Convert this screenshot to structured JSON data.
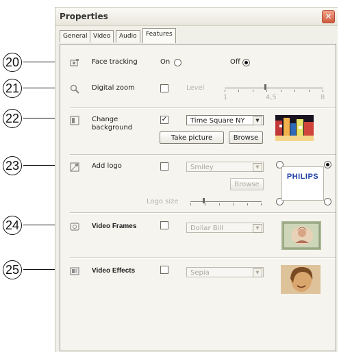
{
  "callouts": [
    "20",
    "21",
    "22",
    "23",
    "24",
    "25"
  ],
  "window": {
    "title": "Properties",
    "close_icon": "close-icon"
  },
  "tabs": [
    {
      "label": "General",
      "active": false
    },
    {
      "label": "Video",
      "active": false
    },
    {
      "label": "Audio",
      "active": false
    },
    {
      "label": "Features",
      "active": true
    }
  ],
  "face_tracking": {
    "label": "Face tracking",
    "on_label": "On",
    "off_label": "Off",
    "selected": "Off"
  },
  "digital_zoom": {
    "label": "Digital zoom",
    "checked": false,
    "level_label": "Level",
    "scale_min": "1",
    "scale_mid": "4,5",
    "scale_max": "8",
    "level_value": 4.5
  },
  "change_background": {
    "label": "Change\nbackground",
    "checked": true,
    "selected": "Time Square NY",
    "take_picture_label": "Take picture",
    "browse_label": "Browse"
  },
  "add_logo": {
    "label": "Add logo",
    "checked": false,
    "selected": "Smiley",
    "browse_label": "Browse",
    "logo_size_label": "Logo size",
    "logo_text": "PHILIPS",
    "logo_size_value": 0.25,
    "position_selected": "top-right"
  },
  "video_frames": {
    "label": "Video Frames",
    "checked": false,
    "selected": "Dollar Bill"
  },
  "video_effects": {
    "label": "Video Effects",
    "checked": false,
    "selected": "Sepia"
  },
  "colors": {
    "accent": "#1f3fa6",
    "close": "#d05b3e"
  }
}
